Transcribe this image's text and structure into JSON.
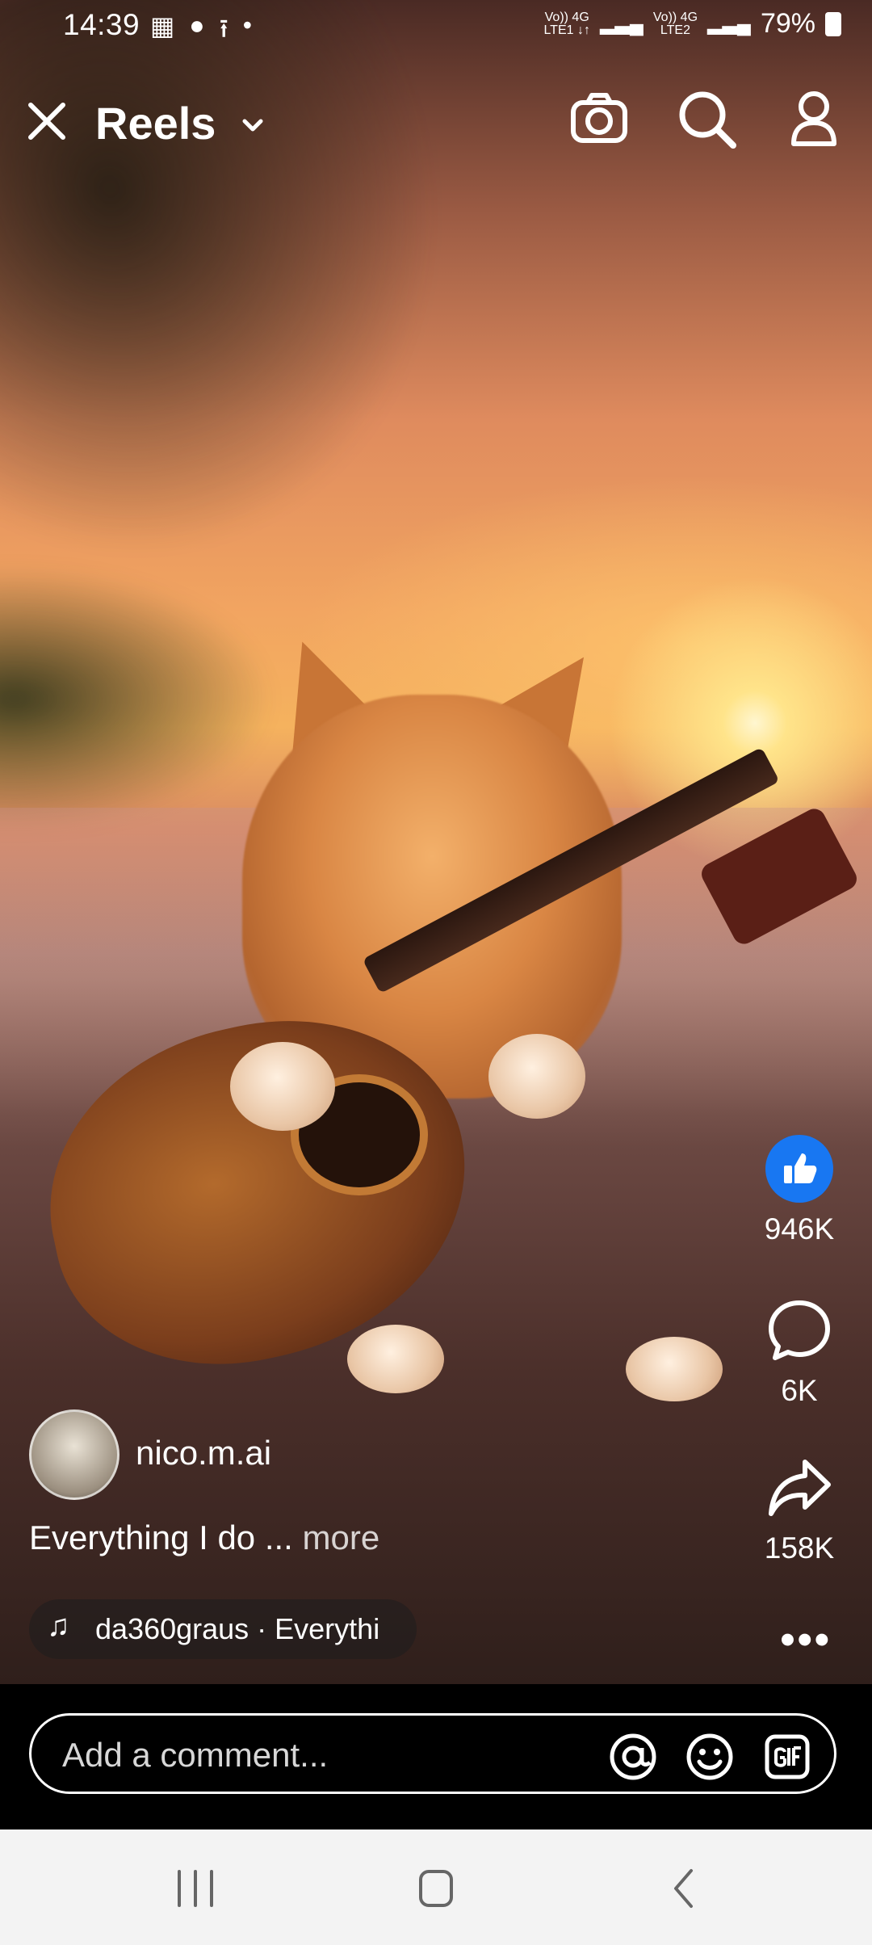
{
  "status_bar": {
    "time": "14:39",
    "sim1_top": "Vo)) 4G",
    "sim1_bottom": "LTE1 ↓↑",
    "sim2_top": "Vo)) 4G",
    "sim2_bottom": "LTE2",
    "battery": "79%"
  },
  "header": {
    "title": "Reels"
  },
  "rail": {
    "likes": "946K",
    "comments": "6K",
    "shares": "158K"
  },
  "post": {
    "username": "nico.m.ai",
    "caption": "Everything I do ...",
    "more_label": "more",
    "music": "da360graus · Everythi"
  },
  "comment": {
    "placeholder": "Add a comment..."
  },
  "colors": {
    "like_blue": "#1877f2"
  }
}
